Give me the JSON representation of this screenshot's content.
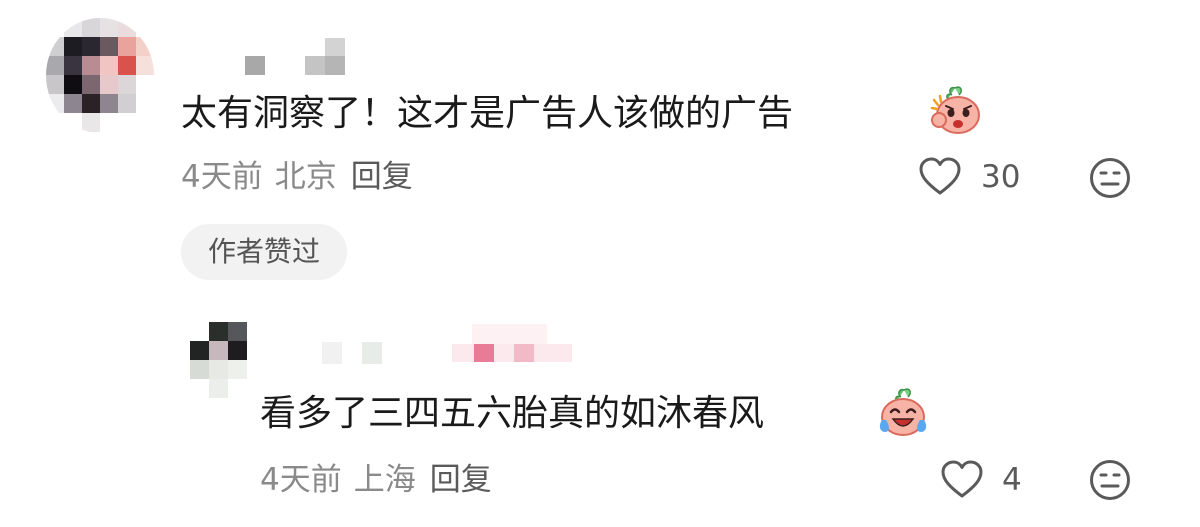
{
  "comment": {
    "text": "太有洞察了！这才是广告人该做的广告",
    "time": "4天前",
    "location": "北京",
    "reply_label": "回复",
    "likes": "30",
    "author_badge": "作者赞过",
    "emoji": "angry-peach-emoji"
  },
  "reply": {
    "text": "看多了三四五六胎真的如沐春风",
    "time": "4天前",
    "location": "上海",
    "reply_label": "回复",
    "likes": "4",
    "emoji": "laughing-crying-peach-emoji"
  },
  "icons": {
    "like": "heart-outline-icon",
    "dislike": "meh-face-icon"
  },
  "colors": {
    "meta_text": "#8a8a8a",
    "badge_bg": "#f2f2f2"
  }
}
